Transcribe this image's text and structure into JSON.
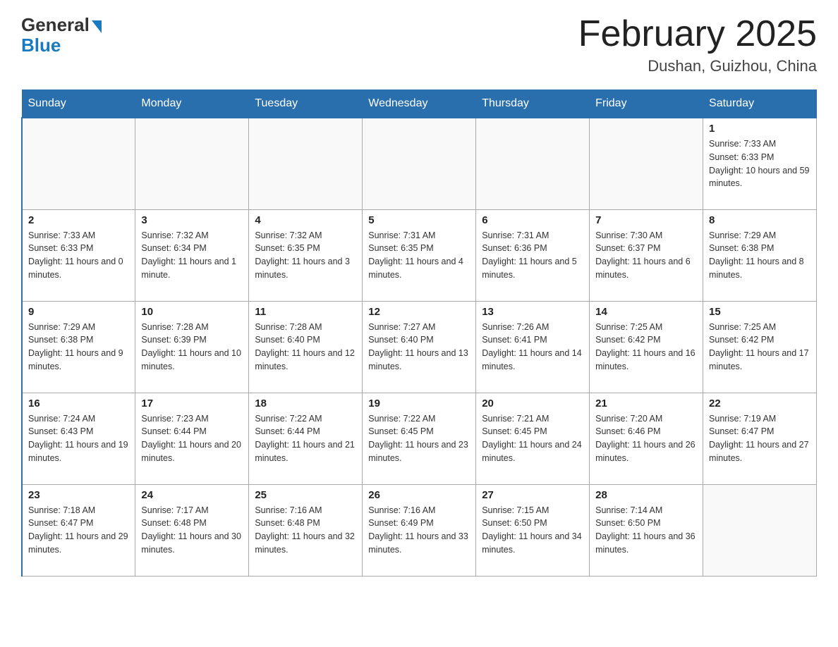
{
  "logo": {
    "general": "General",
    "blue": "Blue"
  },
  "header": {
    "title": "February 2025",
    "location": "Dushan, Guizhou, China"
  },
  "days_of_week": [
    "Sunday",
    "Monday",
    "Tuesday",
    "Wednesday",
    "Thursday",
    "Friday",
    "Saturday"
  ],
  "weeks": [
    [
      {
        "num": "",
        "sunrise": "",
        "sunset": "",
        "daylight": ""
      },
      {
        "num": "",
        "sunrise": "",
        "sunset": "",
        "daylight": ""
      },
      {
        "num": "",
        "sunrise": "",
        "sunset": "",
        "daylight": ""
      },
      {
        "num": "",
        "sunrise": "",
        "sunset": "",
        "daylight": ""
      },
      {
        "num": "",
        "sunrise": "",
        "sunset": "",
        "daylight": ""
      },
      {
        "num": "",
        "sunrise": "",
        "sunset": "",
        "daylight": ""
      },
      {
        "num": "1",
        "sunrise": "Sunrise: 7:33 AM",
        "sunset": "Sunset: 6:33 PM",
        "daylight": "Daylight: 10 hours and 59 minutes."
      }
    ],
    [
      {
        "num": "2",
        "sunrise": "Sunrise: 7:33 AM",
        "sunset": "Sunset: 6:33 PM",
        "daylight": "Daylight: 11 hours and 0 minutes."
      },
      {
        "num": "3",
        "sunrise": "Sunrise: 7:32 AM",
        "sunset": "Sunset: 6:34 PM",
        "daylight": "Daylight: 11 hours and 1 minute."
      },
      {
        "num": "4",
        "sunrise": "Sunrise: 7:32 AM",
        "sunset": "Sunset: 6:35 PM",
        "daylight": "Daylight: 11 hours and 3 minutes."
      },
      {
        "num": "5",
        "sunrise": "Sunrise: 7:31 AM",
        "sunset": "Sunset: 6:35 PM",
        "daylight": "Daylight: 11 hours and 4 minutes."
      },
      {
        "num": "6",
        "sunrise": "Sunrise: 7:31 AM",
        "sunset": "Sunset: 6:36 PM",
        "daylight": "Daylight: 11 hours and 5 minutes."
      },
      {
        "num": "7",
        "sunrise": "Sunrise: 7:30 AM",
        "sunset": "Sunset: 6:37 PM",
        "daylight": "Daylight: 11 hours and 6 minutes."
      },
      {
        "num": "8",
        "sunrise": "Sunrise: 7:29 AM",
        "sunset": "Sunset: 6:38 PM",
        "daylight": "Daylight: 11 hours and 8 minutes."
      }
    ],
    [
      {
        "num": "9",
        "sunrise": "Sunrise: 7:29 AM",
        "sunset": "Sunset: 6:38 PM",
        "daylight": "Daylight: 11 hours and 9 minutes."
      },
      {
        "num": "10",
        "sunrise": "Sunrise: 7:28 AM",
        "sunset": "Sunset: 6:39 PM",
        "daylight": "Daylight: 11 hours and 10 minutes."
      },
      {
        "num": "11",
        "sunrise": "Sunrise: 7:28 AM",
        "sunset": "Sunset: 6:40 PM",
        "daylight": "Daylight: 11 hours and 12 minutes."
      },
      {
        "num": "12",
        "sunrise": "Sunrise: 7:27 AM",
        "sunset": "Sunset: 6:40 PM",
        "daylight": "Daylight: 11 hours and 13 minutes."
      },
      {
        "num": "13",
        "sunrise": "Sunrise: 7:26 AM",
        "sunset": "Sunset: 6:41 PM",
        "daylight": "Daylight: 11 hours and 14 minutes."
      },
      {
        "num": "14",
        "sunrise": "Sunrise: 7:25 AM",
        "sunset": "Sunset: 6:42 PM",
        "daylight": "Daylight: 11 hours and 16 minutes."
      },
      {
        "num": "15",
        "sunrise": "Sunrise: 7:25 AM",
        "sunset": "Sunset: 6:42 PM",
        "daylight": "Daylight: 11 hours and 17 minutes."
      }
    ],
    [
      {
        "num": "16",
        "sunrise": "Sunrise: 7:24 AM",
        "sunset": "Sunset: 6:43 PM",
        "daylight": "Daylight: 11 hours and 19 minutes."
      },
      {
        "num": "17",
        "sunrise": "Sunrise: 7:23 AM",
        "sunset": "Sunset: 6:44 PM",
        "daylight": "Daylight: 11 hours and 20 minutes."
      },
      {
        "num": "18",
        "sunrise": "Sunrise: 7:22 AM",
        "sunset": "Sunset: 6:44 PM",
        "daylight": "Daylight: 11 hours and 21 minutes."
      },
      {
        "num": "19",
        "sunrise": "Sunrise: 7:22 AM",
        "sunset": "Sunset: 6:45 PM",
        "daylight": "Daylight: 11 hours and 23 minutes."
      },
      {
        "num": "20",
        "sunrise": "Sunrise: 7:21 AM",
        "sunset": "Sunset: 6:45 PM",
        "daylight": "Daylight: 11 hours and 24 minutes."
      },
      {
        "num": "21",
        "sunrise": "Sunrise: 7:20 AM",
        "sunset": "Sunset: 6:46 PM",
        "daylight": "Daylight: 11 hours and 26 minutes."
      },
      {
        "num": "22",
        "sunrise": "Sunrise: 7:19 AM",
        "sunset": "Sunset: 6:47 PM",
        "daylight": "Daylight: 11 hours and 27 minutes."
      }
    ],
    [
      {
        "num": "23",
        "sunrise": "Sunrise: 7:18 AM",
        "sunset": "Sunset: 6:47 PM",
        "daylight": "Daylight: 11 hours and 29 minutes."
      },
      {
        "num": "24",
        "sunrise": "Sunrise: 7:17 AM",
        "sunset": "Sunset: 6:48 PM",
        "daylight": "Daylight: 11 hours and 30 minutes."
      },
      {
        "num": "25",
        "sunrise": "Sunrise: 7:16 AM",
        "sunset": "Sunset: 6:48 PM",
        "daylight": "Daylight: 11 hours and 32 minutes."
      },
      {
        "num": "26",
        "sunrise": "Sunrise: 7:16 AM",
        "sunset": "Sunset: 6:49 PM",
        "daylight": "Daylight: 11 hours and 33 minutes."
      },
      {
        "num": "27",
        "sunrise": "Sunrise: 7:15 AM",
        "sunset": "Sunset: 6:50 PM",
        "daylight": "Daylight: 11 hours and 34 minutes."
      },
      {
        "num": "28",
        "sunrise": "Sunrise: 7:14 AM",
        "sunset": "Sunset: 6:50 PM",
        "daylight": "Daylight: 11 hours and 36 minutes."
      },
      {
        "num": "",
        "sunrise": "",
        "sunset": "",
        "daylight": ""
      }
    ]
  ]
}
